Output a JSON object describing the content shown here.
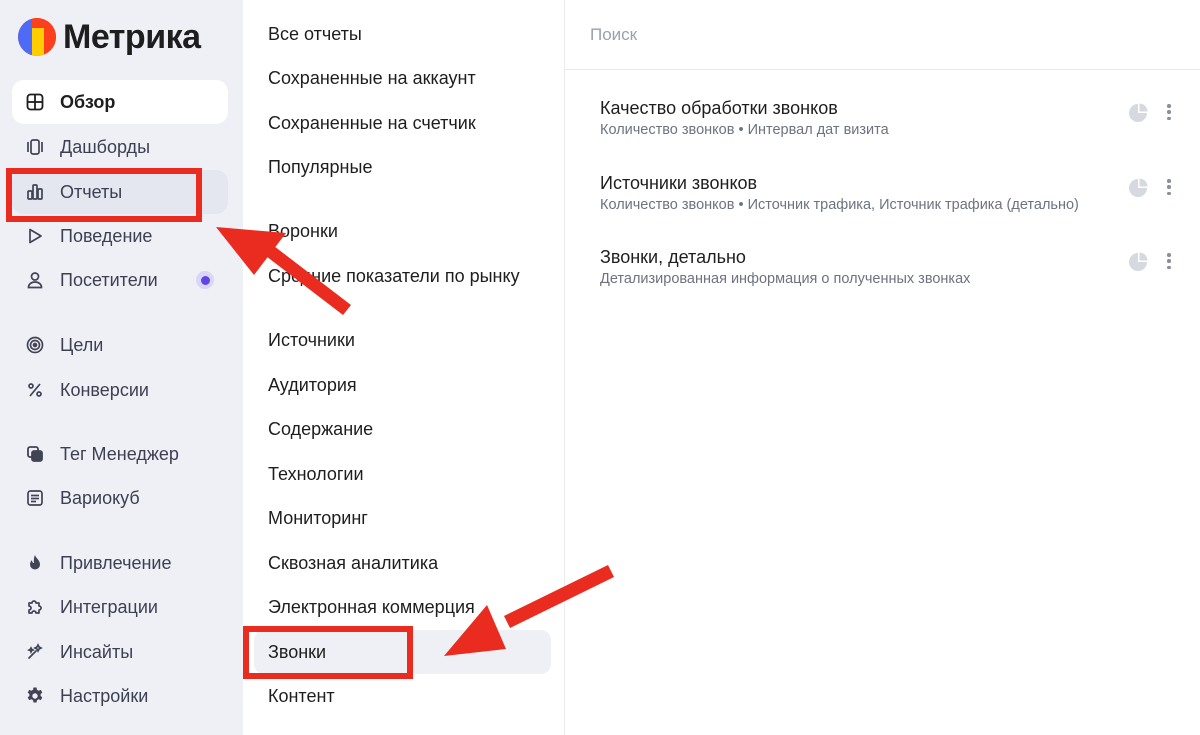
{
  "app": {
    "logo_text": "Метрика"
  },
  "sidebar": {
    "items": [
      {
        "label": "Обзор",
        "icon": "grid-icon"
      },
      {
        "label": "Дашборды",
        "icon": "dashboards-icon"
      },
      {
        "label": "Отчеты",
        "icon": "bar-chart-icon"
      },
      {
        "label": "Поведение",
        "icon": "play-icon"
      },
      {
        "label": "Посетители",
        "icon": "user-icon"
      },
      {
        "label": "Цели",
        "icon": "target-icon"
      },
      {
        "label": "Конверсии",
        "icon": "percent-icon"
      },
      {
        "label": "Тег Менеджер",
        "icon": "tag-manager-icon"
      },
      {
        "label": "Вариокуб",
        "icon": "variocube-icon"
      },
      {
        "label": "Привлечение",
        "icon": "flame-icon"
      },
      {
        "label": "Интеграции",
        "icon": "puzzle-icon"
      },
      {
        "label": "Инсайты",
        "icon": "sparkle-icon"
      },
      {
        "label": "Настройки",
        "icon": "gear-icon"
      }
    ]
  },
  "reports_menu": {
    "items": [
      "Все отчеты",
      "Сохраненные на аккаунт",
      "Сохраненные на счетчик",
      "Популярные",
      "Воронки",
      "Средние показатели по рынку",
      "Источники",
      "Аудитория",
      "Содержание",
      "Технологии",
      "Мониторинг",
      "Сквозная аналитика",
      "Электронная коммерция",
      "Звонки",
      "Контент"
    ],
    "selected": "Звонки"
  },
  "search": {
    "placeholder": "Поиск"
  },
  "reports": [
    {
      "title": "Качество обработки звонков",
      "description": "Количество звонков • Интервал дат визита"
    },
    {
      "title": "Источники звонков",
      "description": "Количество звонков • Источник трафика, Источник трафика (детально)"
    },
    {
      "title": "Звонки, детально",
      "description": "Детализированная информация о полученных звонках"
    }
  ],
  "colors": {
    "sidebar_bg": "#eef0f6",
    "annotation_red": "#ea2b1f",
    "accent_purple": "#6344e6"
  }
}
